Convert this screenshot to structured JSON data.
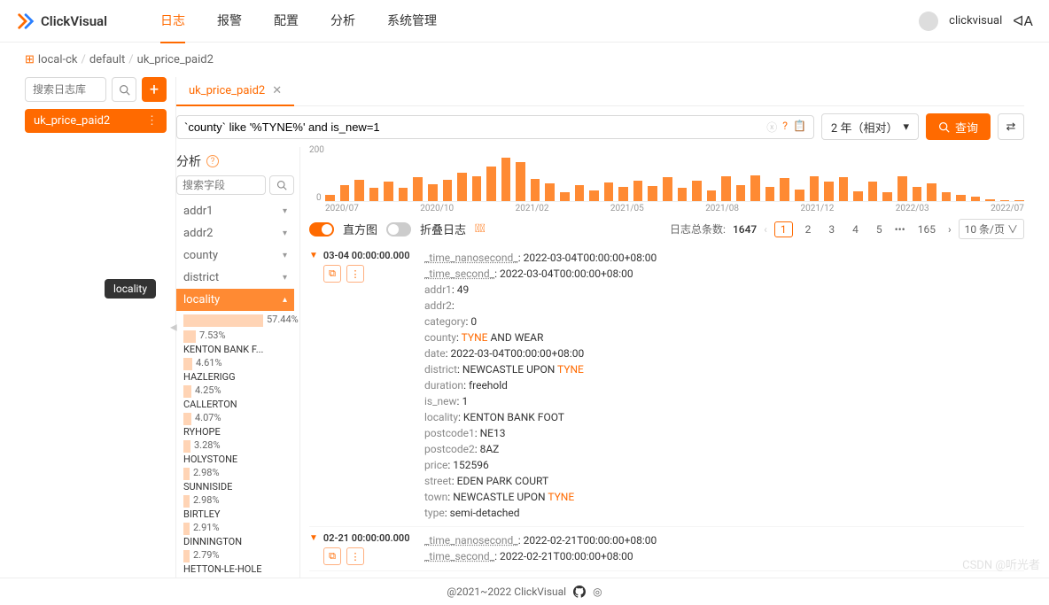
{
  "brand": "ClickVisual",
  "nav": {
    "items": [
      "日志",
      "报警",
      "配置",
      "分析",
      "系统管理"
    ],
    "active": 0
  },
  "user": {
    "name": "clickvisual"
  },
  "breadcrumb": [
    "local-ck",
    "default",
    "uk_price_paid2"
  ],
  "leftSearch": {
    "placeholder": "搜索日志库"
  },
  "tableItem": "uk_price_paid2",
  "tab": {
    "label": "uk_price_paid2"
  },
  "query": {
    "value": "`county` like '%TYNE%' and is_new=1",
    "timeRange": "2 年（相对）",
    "searchLabel": "查询"
  },
  "analysis": {
    "title": "分析",
    "fieldSearchPlaceholder": "搜索字段",
    "fields": [
      "addr1",
      "addr2",
      "county",
      "district",
      "locality"
    ],
    "expanded": "locality",
    "tooltip": "locality",
    "values": [
      {
        "label": "",
        "pct": "57.44%",
        "w": 90
      },
      {
        "label": "KENTON BANK F...",
        "pct": "7.53%",
        "w": 14
      },
      {
        "label": "HAZLERIGG",
        "pct": "4.61%",
        "w": 10
      },
      {
        "label": "CALLERTON",
        "pct": "4.25%",
        "w": 9
      },
      {
        "label": "RYHOPE",
        "pct": "4.07%",
        "w": 9
      },
      {
        "label": "HOLYSTONE",
        "pct": "3.28%",
        "w": 8
      },
      {
        "label": "SUNNISIDE",
        "pct": "2.98%",
        "w": 7
      },
      {
        "label": "BIRTLEY",
        "pct": "2.98%",
        "w": 7
      },
      {
        "label": "DINNINGTON",
        "pct": "2.91%",
        "w": 7
      },
      {
        "label": "HETTON-LE-HOLE",
        "pct": "2.79%",
        "w": 7
      }
    ]
  },
  "chart_data": {
    "type": "bar",
    "ymax": "200",
    "ymin": "0",
    "categories": [
      "2020/07",
      "2020/10",
      "2021/02",
      "2021/05",
      "2021/08",
      "2021/12",
      "2022/03",
      "2022/07"
    ],
    "values": [
      30,
      72,
      95,
      62,
      88,
      60,
      110,
      78,
      96,
      130,
      112,
      155,
      198,
      175,
      100,
      82,
      40,
      72,
      50,
      84,
      66,
      94,
      70,
      108,
      60,
      92,
      50,
      112,
      72,
      118,
      64,
      104,
      52,
      112,
      90,
      108,
      44,
      90,
      42,
      112,
      64,
      80,
      40,
      30,
      20,
      10,
      5,
      3
    ]
  },
  "controls": {
    "histogramLabel": "直方图",
    "foldLabel": "折叠日志",
    "totalLabel": "日志总条数:",
    "total": "1647",
    "pages": [
      "1",
      "2",
      "3",
      "4",
      "5"
    ],
    "lastPage": "165",
    "pageSize": "10 条/页"
  },
  "logs": [
    {
      "ts": "03-04 00:00:00.000",
      "fields": [
        {
          "k": "_time_nanosecond_",
          "v": "2022-03-04T00:00:00+08:00",
          "u": true
        },
        {
          "k": "_time_second_",
          "v": "2022-03-04T00:00:00+08:00",
          "u": true
        },
        {
          "k": "addr1",
          "v": "49"
        },
        {
          "k": "addr2",
          "v": ""
        },
        {
          "k": "category",
          "v": "0"
        },
        {
          "k": "county",
          "v": "TYNE",
          "rest": " AND WEAR",
          "hl": true
        },
        {
          "k": "date",
          "v": "2022-03-04T00:00:00+08:00"
        },
        {
          "k": "district",
          "v": "NEWCASTLE UPON ",
          "rest": "TYNE",
          "hlrest": true
        },
        {
          "k": "duration",
          "v": "freehold"
        },
        {
          "k": "is_new",
          "v": "1"
        },
        {
          "k": "locality",
          "v": "KENTON BANK FOOT"
        },
        {
          "k": "postcode1",
          "v": "NE13"
        },
        {
          "k": "postcode2",
          "v": "8AZ"
        },
        {
          "k": "price",
          "v": "152596"
        },
        {
          "k": "street",
          "v": "EDEN PARK COURT"
        },
        {
          "k": "town",
          "v": "NEWCASTLE UPON ",
          "rest": "TYNE",
          "hlrest": true
        },
        {
          "k": "type",
          "v": "semi-detached"
        }
      ]
    },
    {
      "ts": "02-21 00:00:00.000",
      "fields": [
        {
          "k": "_time_nanosecond_",
          "v": "2022-02-21T00:00:00+08:00",
          "u": true
        },
        {
          "k": "_time_second_",
          "v": "2022-02-21T00:00:00+08:00",
          "u": true
        }
      ]
    }
  ],
  "footer": "@2021~2022 ClickVisual",
  "watermark": "CSDN @听光者"
}
